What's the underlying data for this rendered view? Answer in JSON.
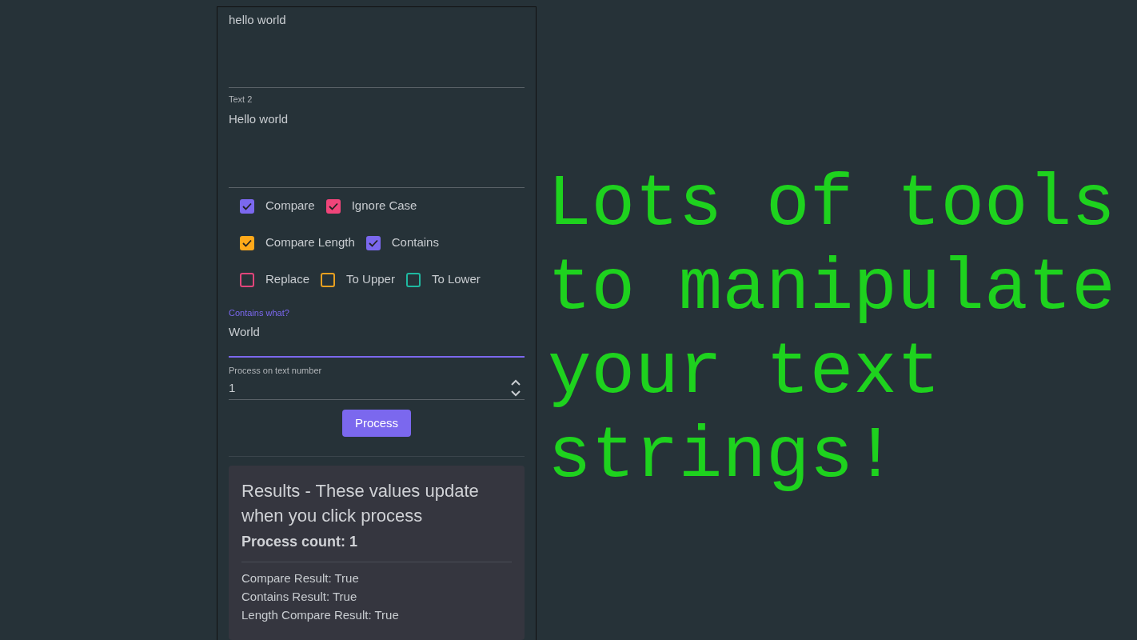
{
  "text1": {
    "value": "hello world"
  },
  "text2": {
    "label": "Text 2",
    "value": "Hello world"
  },
  "option_rows": [
    [
      {
        "label": "Compare",
        "checked": true,
        "color": "#7b68ee"
      },
      {
        "label": "Ignore Case",
        "checked": true,
        "color": "#f0457a"
      }
    ],
    [
      {
        "label": "Compare Length",
        "checked": true,
        "color": "#ffa91a"
      },
      {
        "label": "Contains",
        "checked": true,
        "color": "#7b68ee"
      }
    ],
    [
      {
        "label": "Replace",
        "checked": false,
        "color": "#e0457a"
      },
      {
        "label": "To Upper",
        "checked": false,
        "color": "#e8a020"
      },
      {
        "label": "To Lower",
        "checked": false,
        "color": "#1fb8a0"
      }
    ]
  ],
  "contains_field": {
    "label": "Contains what?",
    "value": "World",
    "focused": true
  },
  "number_field": {
    "label": "Process on text number",
    "value": "1"
  },
  "process_button": "Process",
  "results": {
    "title": "Results - These values update when you click process",
    "count": "Process count: 1",
    "lines": [
      "Compare Result: True",
      "Contains Result: True",
      "Length Compare Result: True"
    ]
  },
  "caption": "Lots of tools to manipulate your text strings!"
}
